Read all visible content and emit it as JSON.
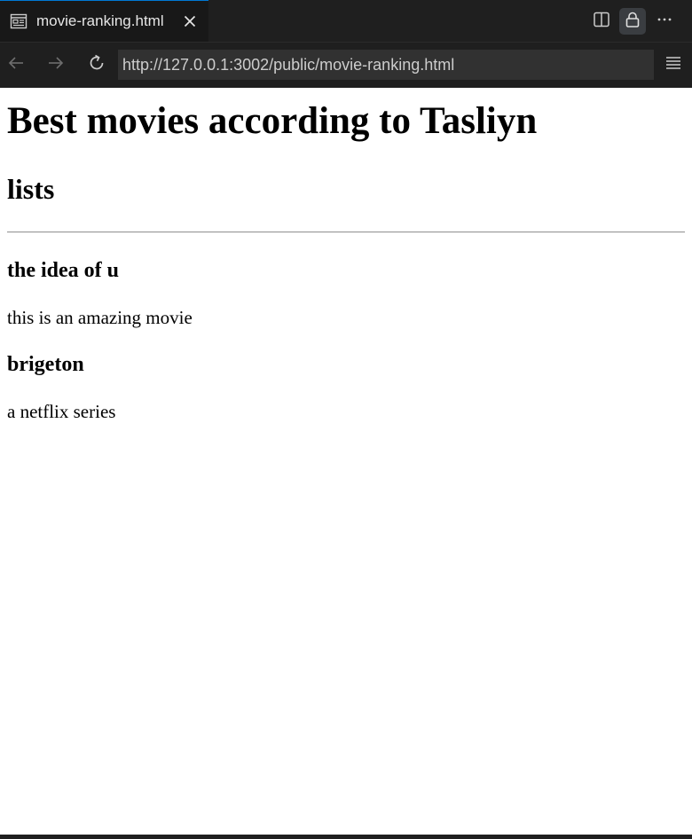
{
  "tab": {
    "title": "movie-ranking.html"
  },
  "toolbar": {
    "split_icon": "split-editor-icon",
    "lock_icon": "lock-icon",
    "more_icon": "more-icon"
  },
  "navbar": {
    "url": "http://127.0.0.1:3002/public/movie-ranking.html",
    "back_icon": "arrow-left-icon",
    "forward_icon": "arrow-right-icon",
    "reload_icon": "reload-icon",
    "menu_icon": "hamburger-menu-icon"
  },
  "page": {
    "title": "Best movies according to Tasliyn",
    "subtitle": "lists",
    "movies": [
      {
        "name": "the idea of u",
        "description": "this is an amazing movie"
      },
      {
        "name": "brigeton",
        "description": "a netflix series"
      }
    ]
  },
  "colors": {
    "chrome_bg": "#1f1f1f",
    "tab_active_bg": "#181818",
    "tab_accent": "#0078d4",
    "url_bg": "#313131"
  }
}
